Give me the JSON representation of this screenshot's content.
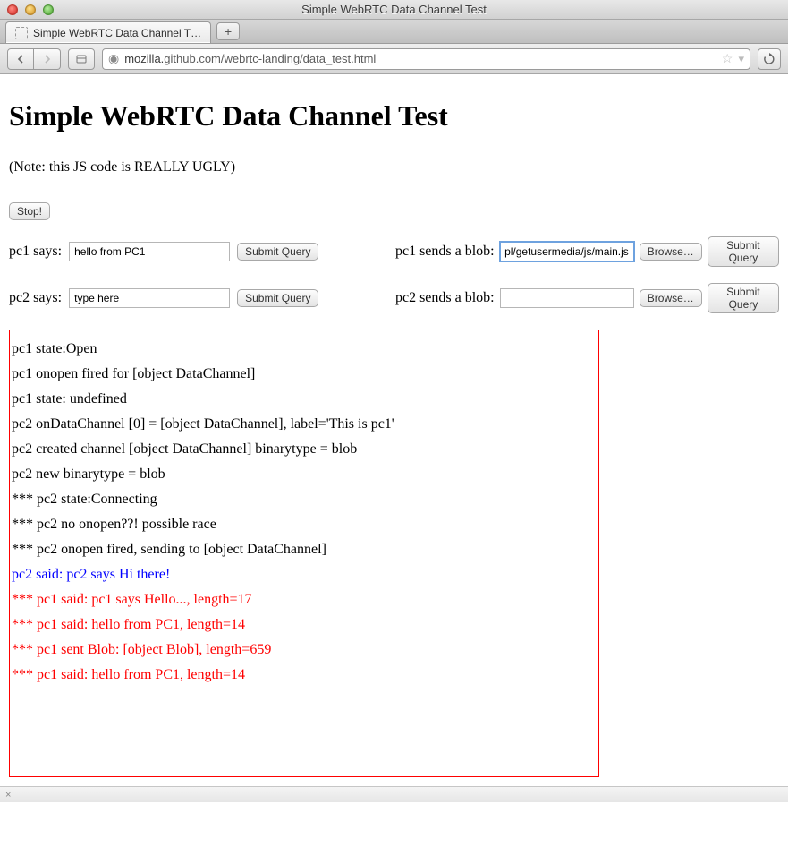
{
  "window": {
    "title": "Simple WebRTC Data Channel Test"
  },
  "tab": {
    "title": "Simple WebRTC Data Channel T…"
  },
  "urlbar": {
    "host": "mozilla.",
    "rest": "github.com/webrtc-landing/data_test.html"
  },
  "page": {
    "heading": "Simple WebRTC Data Channel Test",
    "note": "(Note: this JS code is REALLY UGLY)",
    "stop_btn": "Stop!",
    "pc1_says_label": "pc1 says:",
    "pc1_says_value": "hello from PC1",
    "submit_label": "Submit Query",
    "pc1_blob_label": "pc1 sends a blob:",
    "pc1_blob_file": "pl/getusermedia/js/main.js",
    "browse_label": "Browse…",
    "pc2_says_label": "pc2 says:",
    "pc2_says_value": "type here",
    "pc2_blob_label": "pc2 sends a blob:",
    "pc2_blob_file": ""
  },
  "log": [
    {
      "text": "pc1 state:Open",
      "cls": ""
    },
    {
      "text": "pc1 onopen fired for [object DataChannel]",
      "cls": ""
    },
    {
      "text": "pc1 state: undefined",
      "cls": ""
    },
    {
      "text": "pc2 onDataChannel [0] = [object DataChannel], label='This is pc1'",
      "cls": ""
    },
    {
      "text": "pc2 created channel [object DataChannel] binarytype = blob",
      "cls": ""
    },
    {
      "text": "pc2 new binarytype = blob",
      "cls": ""
    },
    {
      "text": "*** pc2 state:Connecting",
      "cls": ""
    },
    {
      "text": "*** pc2 no onopen??! possible race",
      "cls": ""
    },
    {
      "text": "*** pc2 onopen fired, sending to [object DataChannel]",
      "cls": ""
    },
    {
      "text": "pc2 said: pc2 says Hi there!",
      "cls": "blue"
    },
    {
      "text": "*** pc1 said: pc1 says Hello..., length=17",
      "cls": "red"
    },
    {
      "text": "*** pc1 said: hello from PC1, length=14",
      "cls": "red"
    },
    {
      "text": "*** pc1 sent Blob: [object Blob], length=659",
      "cls": "red"
    },
    {
      "text": "*** pc1 said: hello from PC1, length=14",
      "cls": "red"
    }
  ],
  "status_close": "×"
}
